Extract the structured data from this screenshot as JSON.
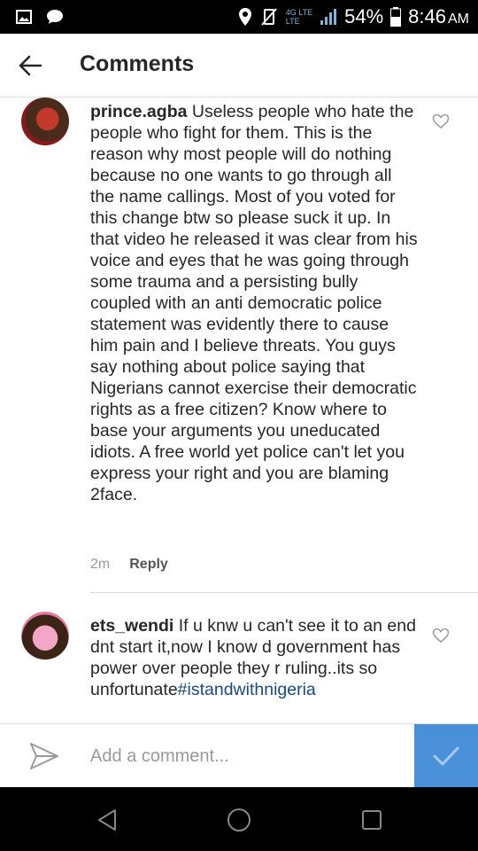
{
  "status_bar": {
    "network_top": "4G LTE",
    "network_bottom": "LTE",
    "battery": "54%",
    "time": "8:46",
    "time_suffix": "AM"
  },
  "app_bar": {
    "title": "Comments",
    "back_icon": "arrow-left-icon"
  },
  "comments": [
    {
      "username": "prince.agba",
      "text": "Useless people who hate the people who fight for them. This is the reason why most people will do nothing because no one wants to go through all the name callings. Most of you voted for this change btw so please suck it up.  In that video he released it was clear from his voice and eyes that he was going through some trauma and a persisting bully coupled with an anti democratic police statement was evidently there to cause him pain and I believe threats. You guys say nothing about police saying that Nigerians cannot exercise their democratic rights as a free citizen? Know where to base your arguments you uneducated idiots. A free world yet police can't let you express your right and you are blaming 2face.",
      "time": "2m",
      "reply_label": "Reply"
    },
    {
      "username": "ets_wendi",
      "text": "If u knw u can't see it to an end dnt start it,now I know d government has power over people they r ruling..its so unfortunate",
      "hashtag": "#istandwithnigeria"
    }
  ],
  "composer": {
    "placeholder": "Add a comment..."
  },
  "colors": {
    "accent": "#4a90d9",
    "hashtag": "#1a4a7a",
    "text": "#262626",
    "muted": "#999999"
  }
}
